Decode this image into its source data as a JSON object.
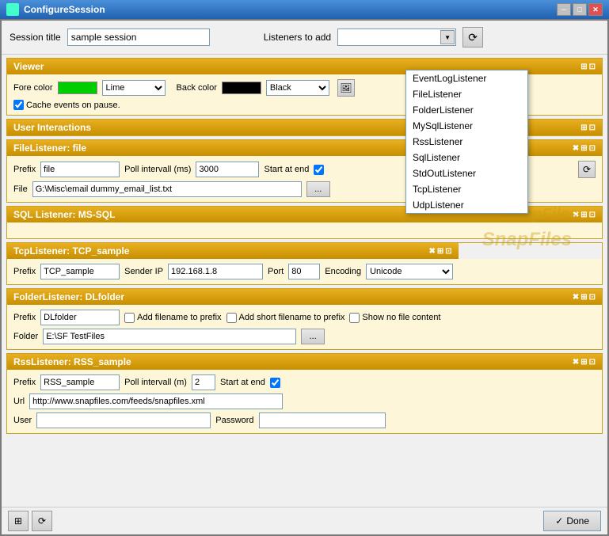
{
  "titleBar": {
    "title": "ConfigureSession",
    "controls": [
      "minimize",
      "maximize",
      "close"
    ]
  },
  "header": {
    "sessionLabel": "Session title",
    "sessionValue": "sample session",
    "listenersLabel": "Listeners to add"
  },
  "dropdown": {
    "items": [
      "EventLogListener",
      "FileListener",
      "FolderListener",
      "MySqlListener",
      "RssListener",
      "SqlListener",
      "StdOutListener",
      "TcpListener",
      "UdpListener"
    ]
  },
  "sections": {
    "viewer": {
      "title": "Viewer",
      "foreLabel": "Fore color",
      "foreColor": "#00cc00",
      "foreColorName": "Lime",
      "backLabel": "Back color",
      "backColor": "#000000",
      "backColorName": "Black",
      "cacheLabel": "Cache events on pause."
    },
    "userInteractions": {
      "title": "User Interactions"
    },
    "fileListener": {
      "title": "FileListener: file",
      "prefixLabel": "Prefix",
      "prefixValue": "file",
      "pollLabel": "Poll intervall (ms)",
      "pollValue": "3000",
      "startLabel": "Start at end",
      "fileLabel": "File",
      "fileValue": "G:\\Misc\\email dummy_email_list.txt"
    },
    "sqlListener": {
      "title": "SQL Listener: MS-SQL",
      "watermark": "SnapFiles"
    },
    "tcpListener": {
      "title": "TcpListener: TCP_sample",
      "prefixLabel": "Prefix",
      "prefixValue": "TCP_sample",
      "senderLabel": "Sender IP",
      "senderValue": "192.168.1.8",
      "portLabel": "Port",
      "portValue": "80",
      "encodingLabel": "Encoding",
      "encodingValue": "Unicode"
    },
    "folderListener": {
      "title": "FolderListener: DLfolder",
      "prefixLabel": "Prefix",
      "prefixValue": "DLfolder",
      "addFilenameLabel": "Add filename to prefix",
      "addShortLabel": "Add short filename to prefix",
      "showNoFileLabel": "Show no file content",
      "folderLabel": "Folder",
      "folderValue": "E:\\SF TestFiles"
    },
    "rssListener": {
      "title": "RssListener: RSS_sample",
      "prefixLabel": "Prefix",
      "prefixValue": "RSS_sample",
      "pollLabel": "Poll intervall (m)",
      "pollValue": "2",
      "startLabel": "Start at end",
      "urlLabel": "Url",
      "urlValue": "http://www.snapfiles.com/feeds/snapfiles.xml",
      "userLabel": "User",
      "userValue": "",
      "passwordLabel": "Password",
      "passwordValue": ""
    }
  },
  "footer": {
    "doneLabel": "Done",
    "doneIcon": "✓"
  },
  "icons": {
    "refresh": "⟳",
    "browse": "...",
    "delete": "✖",
    "expand": "◆",
    "collapse": "◆",
    "grid1": "⊞",
    "grid2": "⊡",
    "checkmark": "✓"
  }
}
